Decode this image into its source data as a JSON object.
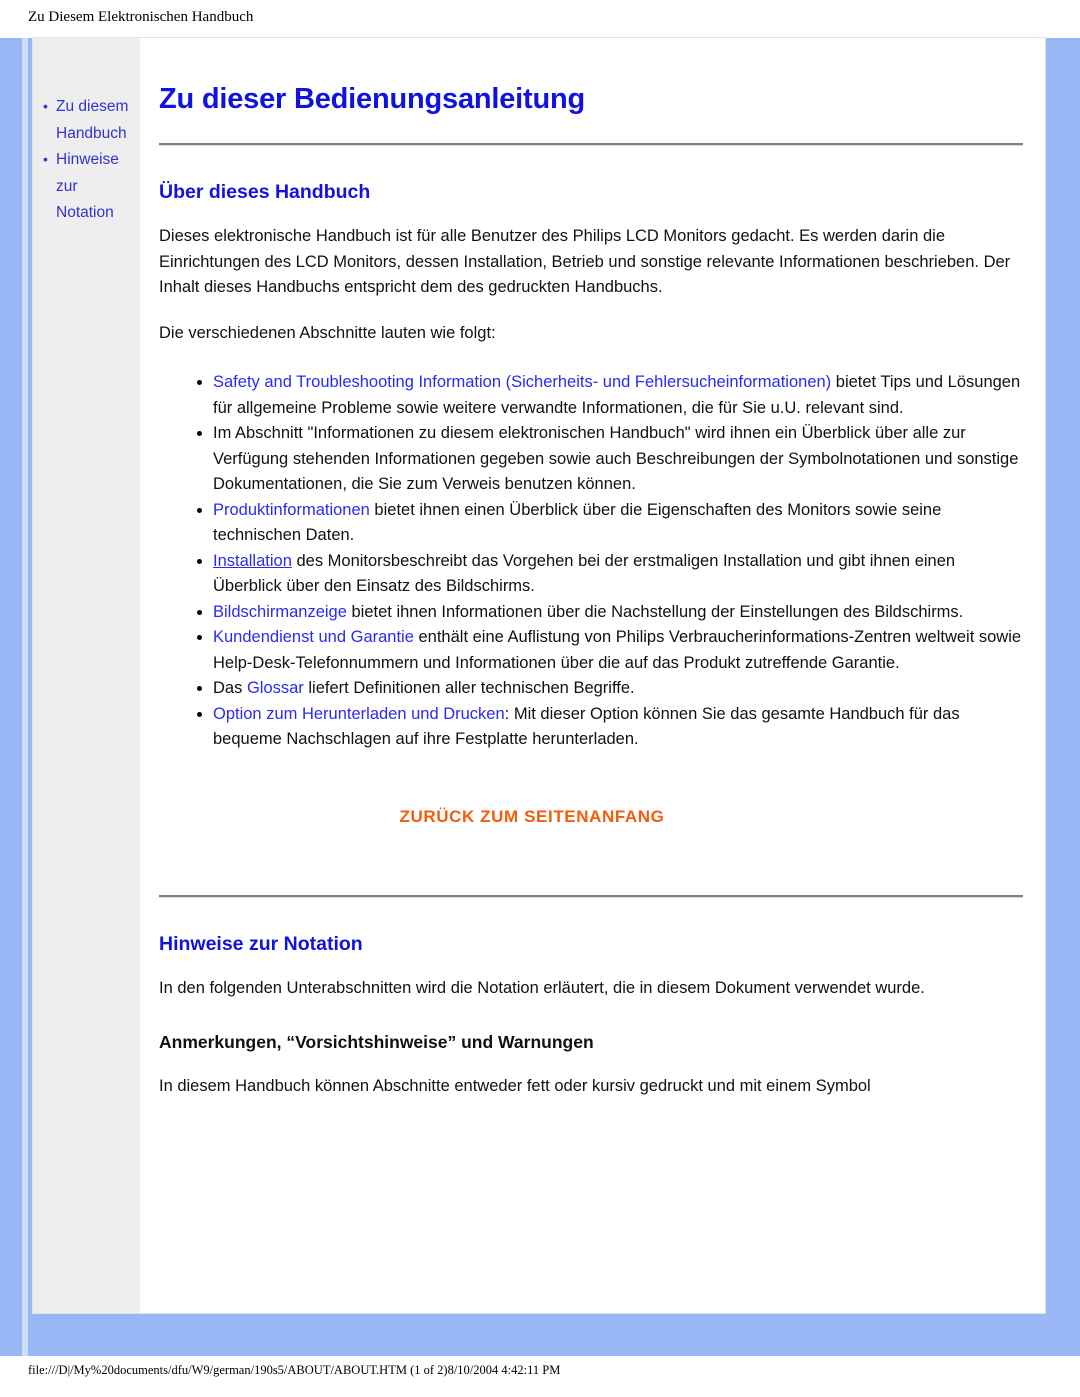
{
  "print_header": {
    "title": "Zu Diesem Elektronischen Handbuch"
  },
  "sidebar": {
    "items": [
      {
        "label": "Zu diesem Handbuch"
      },
      {
        "label": "Hinweise zur Notation"
      }
    ]
  },
  "document": {
    "title": "Zu dieser Bedienungsanleitung",
    "section_about": {
      "heading": "Über dieses Handbuch",
      "intro_paragraph": "Dieses elektronische Handbuch ist für alle Benutzer des Philips LCD Monitors gedacht. Es werden darin die Einrichtungen des LCD Monitors, dessen Installation, Betrieb und sonstige relevante Informationen beschrieben. Der Inhalt dieses Handbuchs entspricht dem des gedruckten Handbuchs.",
      "lead_in": "Die verschiedenen Abschnitte lauten wie folgt:",
      "bullets": [
        {
          "link": "Safety and Troubleshooting Information (Sicherheits- und Fehlersucheinformationen)",
          "link_underlined": false,
          "prefix": "",
          "text": " bietet Tips und Lösungen für allgemeine Probleme sowie weitere verwandte Informationen, die für Sie u.U. relevant sind."
        },
        {
          "link": "",
          "link_underlined": false,
          "prefix": "",
          "text": "Im Abschnitt \"Informationen zu diesem elektronischen Handbuch\" wird ihnen ein Überblick über alle zur Verfügung stehenden Informationen gegeben sowie auch Beschreibungen der Symbolnotationen und sonstige Dokumentationen, die Sie zum Verweis benutzen können."
        },
        {
          "link": "Produktinformationen",
          "link_underlined": false,
          "prefix": "",
          "text": " bietet ihnen einen Überblick über die Eigenschaften des Monitors sowie seine technischen Daten."
        },
        {
          "link": "Installation",
          "link_underlined": true,
          "prefix": "",
          "text": " des Monitorsbeschreibt das Vorgehen bei der erstmaligen Installation und gibt ihnen einen Überblick über den Einsatz des Bildschirms."
        },
        {
          "link": "Bildschirmanzeige",
          "link_underlined": false,
          "prefix": "",
          "text": " bietet ihnen Informationen über die Nachstellung der Einstellungen des Bildschirms."
        },
        {
          "link": "Kundendienst und Garantie",
          "link_underlined": false,
          "prefix": "",
          "text": " enthält eine Auflistung von Philips Verbraucherinformations-Zentren weltweit sowie Help-Desk-Telefonnummern und Informationen über die auf das Produkt zutreffende Garantie."
        },
        {
          "link": "Glossar",
          "link_underlined": false,
          "prefix": "Das ",
          "text": " liefert Definitionen aller technischen Begriffe."
        },
        {
          "link": "Option zum Herunterladen und Drucken",
          "link_underlined": false,
          "prefix": "",
          "text": ": Mit dieser Option können Sie das gesamte Handbuch für das bequeme Nachschlagen auf ihre Festplatte herunterladen."
        }
      ],
      "back_to_top": "ZURÜCK ZUM SEITENANFANG"
    },
    "section_notation": {
      "heading": "Hinweise zur Notation",
      "paragraph": "In den folgenden Unterabschnitten wird die Notation erläutert, die in diesem Dokument verwendet wurde.",
      "sub_heading": "Anmerkungen, “Vorsichtshinweise” und Warnungen",
      "paragraph2": "In diesem Handbuch können Abschnitte entweder fett oder kursiv gedruckt und mit einem Symbol"
    }
  },
  "print_footer": {
    "path": "file:///D|/My%20documents/dfu/W9/german/190s5/ABOUT/ABOUT.HTM (1 of 2)8/10/2004 4:42:11 PM"
  },
  "colors": {
    "page_background": "#9ab7f5",
    "sidebar_background": "#eeeeee",
    "heading_blue": "#1212e0",
    "link_blue": "#2b2bf0",
    "accent_orange": "#f25c0a",
    "body_text": "#111111"
  }
}
